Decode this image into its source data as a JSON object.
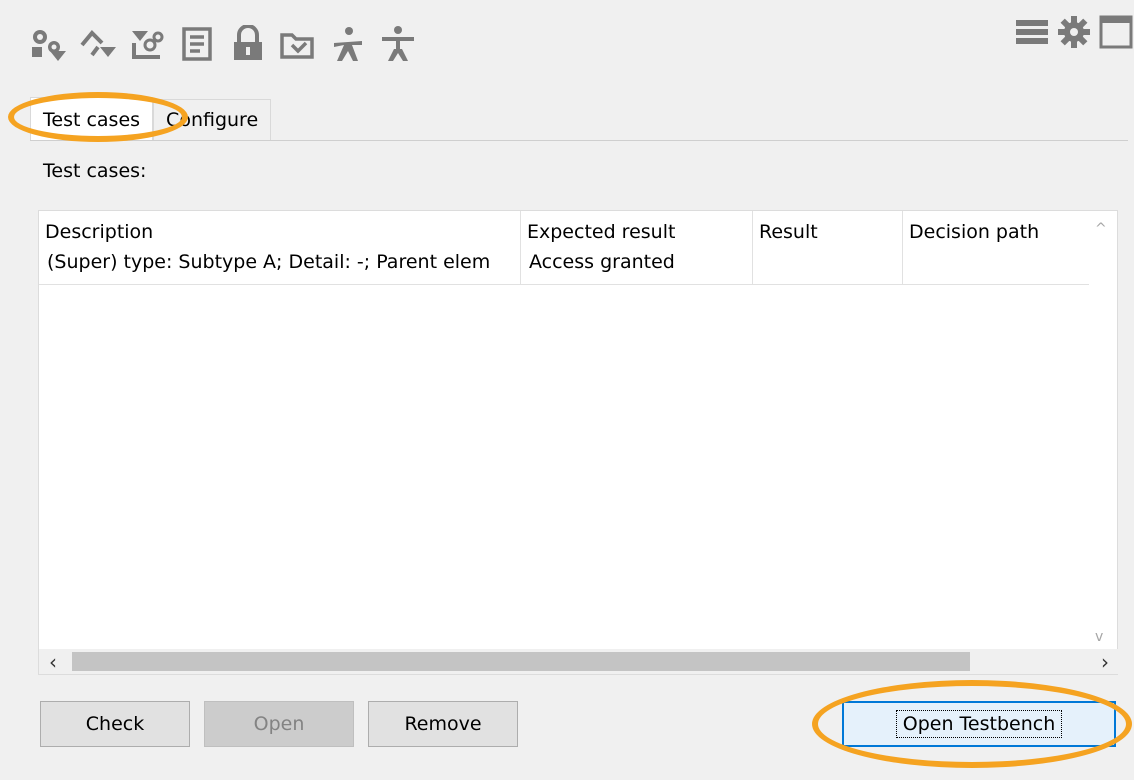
{
  "toolbar": {
    "icons": [
      "gears-filter-icon",
      "shapes-filter-icon",
      "hierarchy-filter-icon",
      "document-filter-icon",
      "lock-icon",
      "folder-icon",
      "person-walking-icon",
      "person-standing-icon"
    ]
  },
  "window_controls": {
    "icons": [
      "menu-icon",
      "settings-icon",
      "window-icon"
    ]
  },
  "tabs": [
    {
      "label": "Test cases",
      "active": true
    },
    {
      "label": "Configure",
      "active": false
    }
  ],
  "section_label": "Test cases:",
  "table": {
    "columns": [
      {
        "header": "Description"
      },
      {
        "header": "Expected result"
      },
      {
        "header": "Result"
      },
      {
        "header": "Decision path"
      }
    ],
    "rows": [
      {
        "description": "(Super) type: Subtype A; Detail: -; Parent elem",
        "expected": "Access granted",
        "result": "",
        "decision_path": ""
      }
    ]
  },
  "buttons": {
    "check": "Check",
    "open": "Open",
    "remove": "Remove",
    "open_testbench": "Open Testbench"
  },
  "colors": {
    "highlight": "#f5a321",
    "default_button_border": "#0078d7"
  }
}
